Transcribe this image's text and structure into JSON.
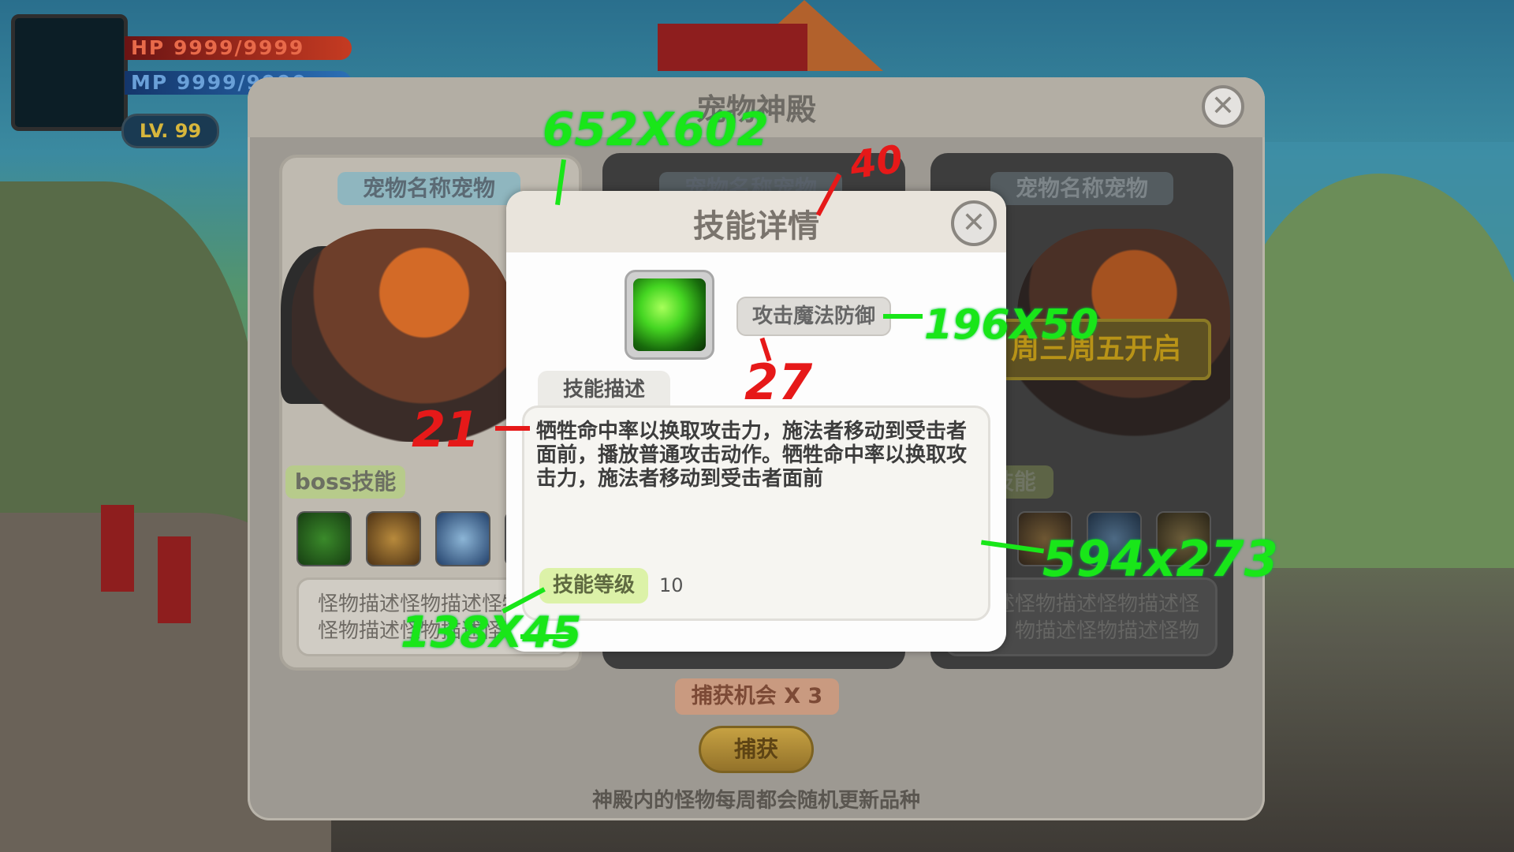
{
  "hud": {
    "hp": "HP 9999/9999",
    "mp": "MP 9999/9999",
    "level": "LV. 99"
  },
  "panel": {
    "title": "宠物神殿",
    "cards": [
      {
        "name": "宠物名称宠物",
        "skills_label": "boss技能",
        "description": "怪物描述怪物描述怪物描述怪物描述怪物描述怪物"
      },
      {
        "name": "宠物名称宠物"
      },
      {
        "name": "宠物名称宠物",
        "banner": "周三周五开启",
        "skills_label": "技能",
        "description": "描述怪物描述怪物描述怪物描述怪物描述怪物"
      }
    ],
    "capture_chance": "捕获机会 X 3",
    "capture_button": "捕获",
    "footer": "神殿内的怪物每周都会随机更新品种"
  },
  "modal": {
    "title": "技能详情",
    "skill_type": "攻击魔法防御",
    "description_tab": "技能描述",
    "description": "牺牲命中率以换取攻击力，施法者移动到受击者面前，播放普通攻击动作。牺牲命中率以换取攻击力，施法者移动到受击者面前",
    "level_label": "技能等级",
    "level_value": "10"
  },
  "annotations": {
    "modal_size": "652X602",
    "header_height": "40",
    "tag_size": "196X50",
    "tag_gap": "27",
    "desc_gap": "21",
    "desc_box_size": "594x273",
    "level_tag_size": "138X45"
  },
  "colors": {
    "accent_green": "#19e619",
    "annotation_red": "#e61919",
    "panel_bg": "#9d9992",
    "modal_bg": "#fdfdfd"
  },
  "icons": [
    "close-icon",
    "skill-whirlwind-icon",
    "heal-icon",
    "fist-icon",
    "shield-icon"
  ]
}
